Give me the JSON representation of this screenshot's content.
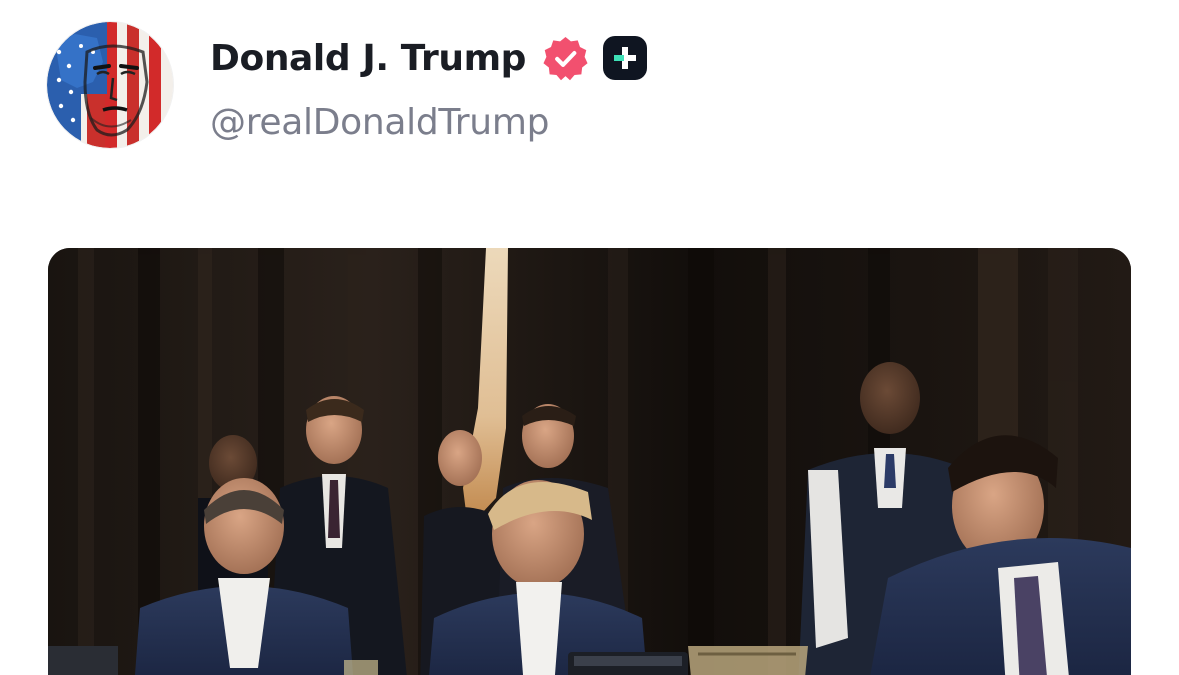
{
  "post": {
    "author": {
      "display_name": "Donald J. Trump",
      "handle": "@realDonaldTrump",
      "verified_icon": "verified-check-icon",
      "plus_icon": "truth-plus-icon",
      "avatar_icon": "avatar-image"
    },
    "media": {
      "icon": "photo-image"
    }
  },
  "colors": {
    "name_text": "#1a1d24",
    "handle_text": "#7b7e8c",
    "verified_badge": "#f2506f",
    "plus_badge_bg": "#0f1521",
    "plus_badge_accent": "#3ee0b7"
  }
}
